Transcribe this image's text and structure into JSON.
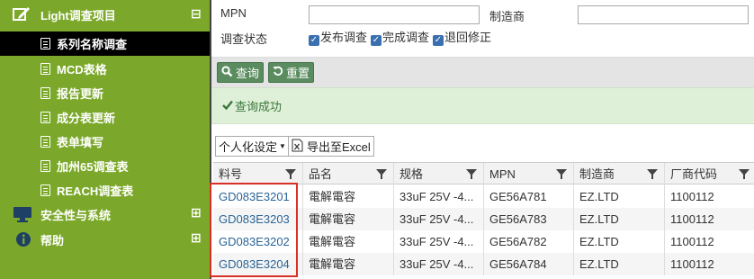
{
  "sidebar": {
    "header": "Light调查项目",
    "items": [
      {
        "label": "系列名称调查",
        "active": true
      },
      {
        "label": "MCD表格"
      },
      {
        "label": "报告更新"
      },
      {
        "label": "成分表更新"
      },
      {
        "label": "表单填写"
      },
      {
        "label": "加州65调查表"
      },
      {
        "label": "REACH调查表"
      }
    ],
    "groups": [
      {
        "label": "安全性与系统",
        "icon": "monitor-icon"
      },
      {
        "label": "帮助",
        "icon": "info-icon"
      }
    ],
    "collapse_glyph": "⊟",
    "expand_glyph": "⊞"
  },
  "form": {
    "mpn_label": "MPN",
    "mpn_value": "",
    "manufacturer_label": "制造商",
    "manufacturer_value": "",
    "status_label": "调查状态",
    "checkboxes": [
      {
        "label": "发布调查",
        "checked": true
      },
      {
        "label": "完成调查",
        "checked": true
      },
      {
        "label": "退回修正",
        "checked": true
      }
    ]
  },
  "toolbar": {
    "query_label": "查询",
    "reset_label": "重置"
  },
  "alert": {
    "message": "查询成功"
  },
  "grid_tools": {
    "personalize_label": "个人化设定",
    "export_label": "导出至Excel"
  },
  "table": {
    "columns": [
      "料号",
      "品名",
      "规格",
      "MPN",
      "制造商",
      "厂商代码"
    ],
    "rows": [
      [
        "GD083E3201",
        "電解電容",
        "33uF 25V -4...",
        "GE56A781",
        "EZ.LTD",
        "1100112"
      ],
      [
        "GD083E3203",
        "電解電容",
        "33uF 25V -4...",
        "GE56A783",
        "EZ.LTD",
        "1100112"
      ],
      [
        "GD083E3202",
        "電解電容",
        "33uF 25V -4...",
        "GE56A782",
        "EZ.LTD",
        "1100112"
      ],
      [
        "GD083E3204",
        "電解電容",
        "33uF 25V -4...",
        "GE56A784",
        "EZ.LTD",
        "1100112"
      ]
    ]
  },
  "colors": {
    "sidebar_bg": "#7ba82a",
    "active_bg": "#000000",
    "link": "#2a6496",
    "success_bg": "#dff0d8",
    "highlight": "#d93025"
  }
}
